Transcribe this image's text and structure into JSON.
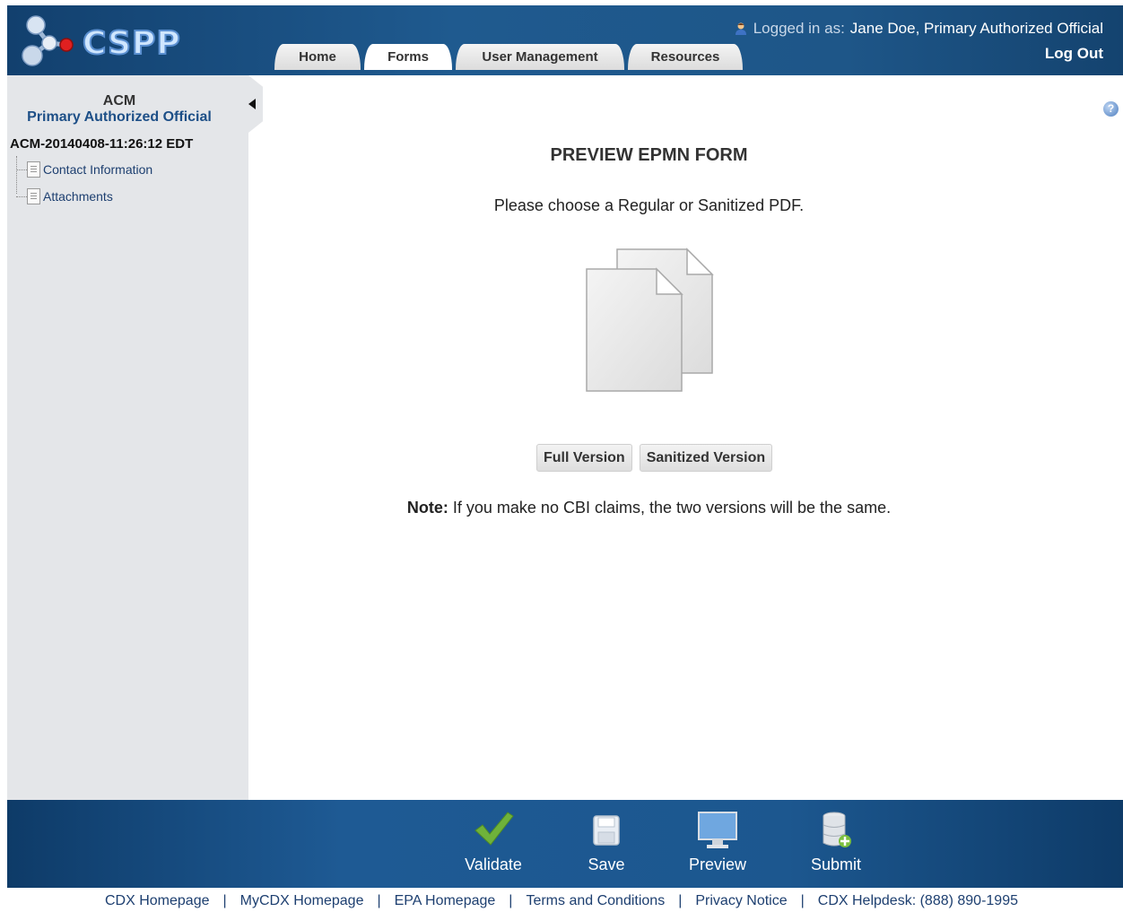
{
  "header": {
    "logo_text": "CSPP",
    "logged_in_prefix": "Logged in as:",
    "user_name": "Jane Doe, Primary Authorized Official",
    "logout_label": "Log Out"
  },
  "tabs": [
    {
      "label": "Home",
      "active": false
    },
    {
      "label": "Forms",
      "active": true
    },
    {
      "label": "User Management",
      "active": false
    },
    {
      "label": "Resources",
      "active": false
    }
  ],
  "sidebar": {
    "title": "ACM",
    "role": "Primary Authorized Official",
    "submission_id": "ACM-20140408-11:26:12 EDT",
    "items": [
      {
        "label": "Contact Information"
      },
      {
        "label": "Attachments"
      }
    ]
  },
  "main": {
    "title": "PREVIEW EPMN FORM",
    "instructions": "Please choose a Regular or Sanitized PDF.",
    "full_version_label": "Full Version",
    "sanitized_version_label": "Sanitized Version",
    "note_label": "Note:",
    "note_text": " If you make no CBI claims, the two versions will be the same."
  },
  "actions": {
    "validate": "Validate",
    "save": "Save",
    "preview": "Preview",
    "submit": "Submit"
  },
  "footer": {
    "links": [
      "CDX Homepage",
      "MyCDX Homepage",
      "EPA Homepage",
      "Terms and Conditions",
      "Privacy Notice",
      "CDX Helpdesk: (888) 890-1995"
    ]
  },
  "colors": {
    "header_blue": "#1f5a8f",
    "sidebar_gray": "#e4e6e9",
    "link_blue": "#1d3f70",
    "validate_green": "#6fb23a"
  }
}
